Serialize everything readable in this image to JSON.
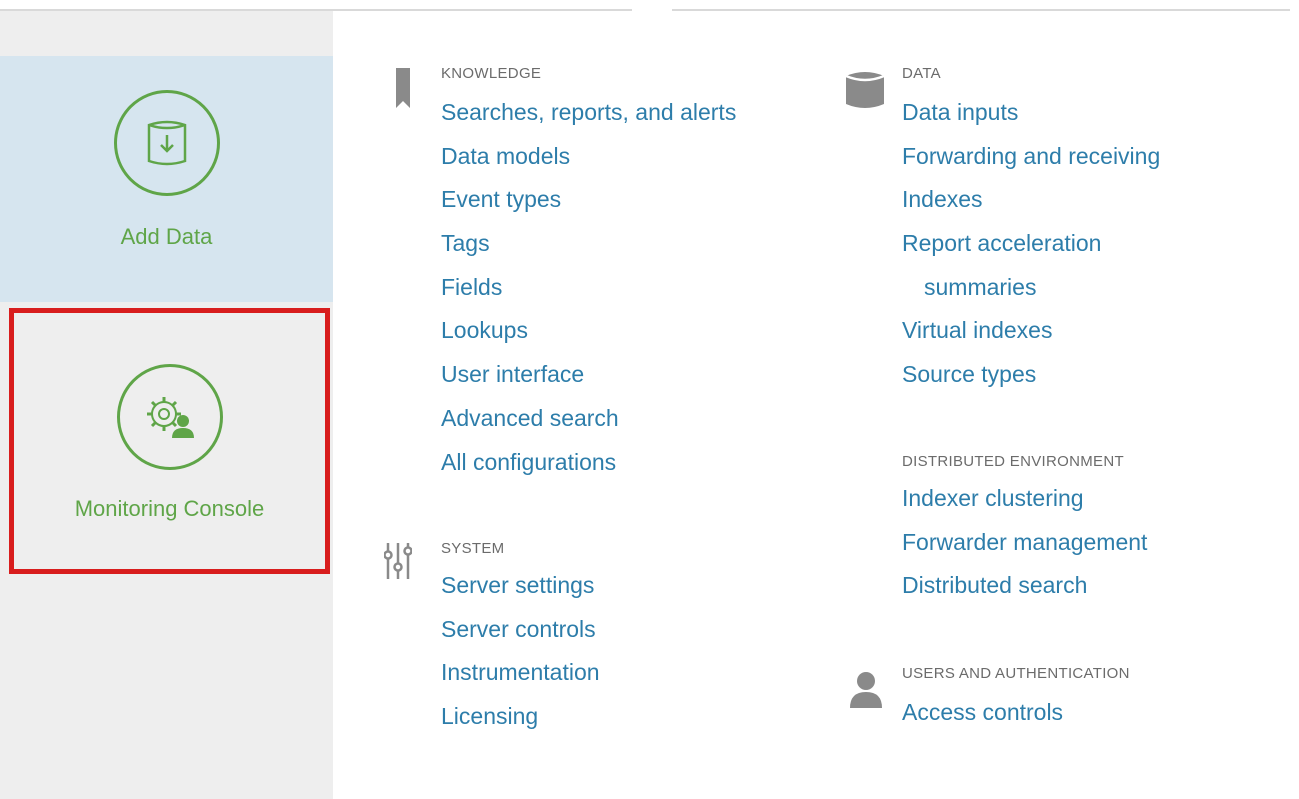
{
  "sidebar": {
    "tiles": [
      {
        "label": "Add Data",
        "icon": "database-download-icon"
      },
      {
        "label": "Monitoring Console",
        "icon": "gear-user-icon"
      }
    ]
  },
  "knowledge": {
    "title": "KNOWLEDGE",
    "icon": "bookmark-icon",
    "links": [
      "Searches, reports, and alerts",
      "Data models",
      "Event types",
      "Tags",
      "Fields",
      "Lookups",
      "User interface",
      "Advanced search",
      "All configurations"
    ]
  },
  "system": {
    "title": "SYSTEM",
    "icon": "sliders-icon",
    "links": [
      "Server settings",
      "Server controls",
      "Instrumentation",
      "Licensing"
    ]
  },
  "data": {
    "title": "DATA",
    "icon": "database-icon",
    "links": [
      "Data inputs",
      "Forwarding and receiving",
      "Indexes",
      "Report acceleration",
      "summaries",
      "Virtual indexes",
      "Source types"
    ]
  },
  "distributed": {
    "title": "DISTRIBUTED ENVIRONMENT",
    "links": [
      "Indexer clustering",
      "Forwarder management",
      "Distributed search"
    ]
  },
  "users": {
    "title": "USERS AND AUTHENTICATION",
    "icon": "user-icon",
    "links": [
      "Access controls"
    ]
  },
  "colors": {
    "accent_green": "#5fa548",
    "link_blue": "#2d7daa",
    "highlight_red": "#d81d1d",
    "selected_tile_bg": "#d6e5ef",
    "sidebar_bg": "#eeeeee"
  }
}
